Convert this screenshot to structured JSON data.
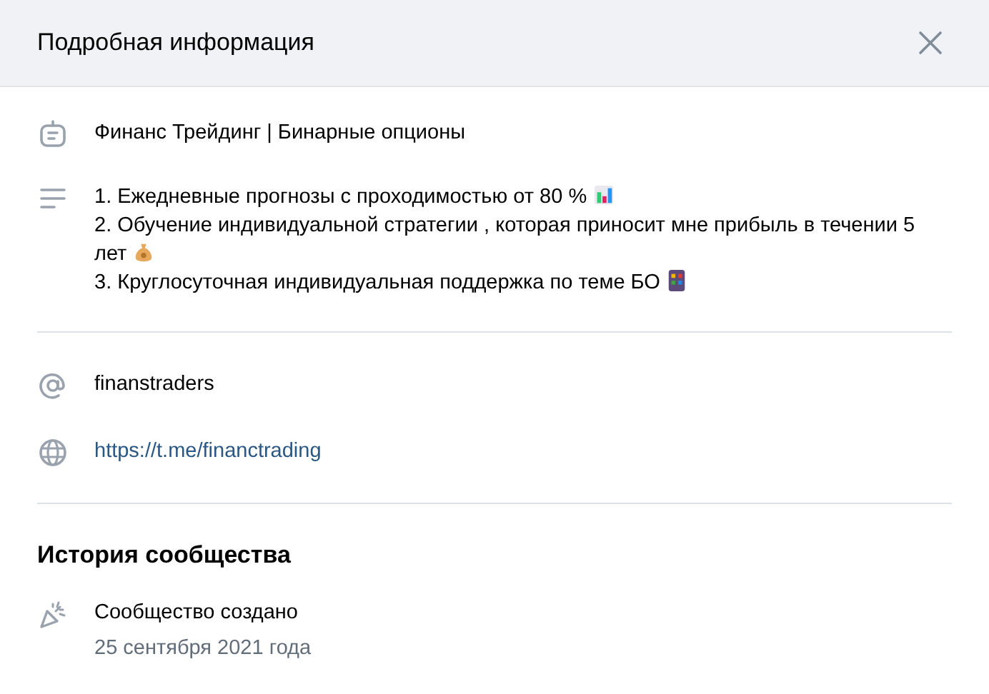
{
  "header": {
    "title": "Подробная информация"
  },
  "info": {
    "name": "Финанс Трейдинг | Бинарные опционы",
    "description": [
      {
        "text": "1. Ежедневные прогнозы с проходимостью от 80 %",
        "kind": "chart"
      },
      {
        "text": "2. Обучение индивидуальной стратегии , которая приносит мне прибыль в течении 5 лет",
        "kind": "money"
      },
      {
        "text": "3. Круглосуточная индивидуальная поддержка по теме БО",
        "kind": "grid"
      }
    ]
  },
  "contacts": {
    "handle": "finanstraders",
    "link": "https://t.me/financtrading"
  },
  "history": {
    "title": "История сообщества",
    "event": "Сообщество создано",
    "date": "25 сентября 2021 года"
  }
}
